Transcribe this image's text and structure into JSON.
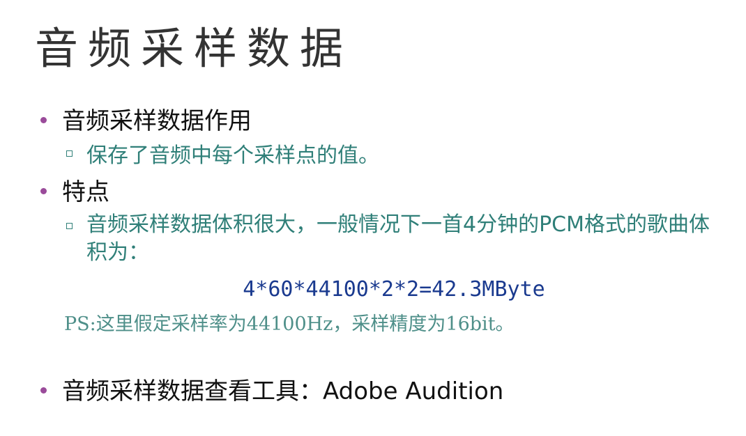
{
  "title": "音频采样数据",
  "items": [
    {
      "text": "音频采样数据作用",
      "sub": "保存了音频中每个采样点的值。"
    },
    {
      "text": "特点",
      "sub": "音频采样数据体积很大，一般情况下一首4分钟的PCM格式的歌曲体积为："
    },
    {
      "text": "音频采样数据查看工具：Adobe Audition"
    }
  ],
  "formula": "4*60*44100*2*2=42.3MByte",
  "note": "PS:这里假定采样率为44100Hz，采样精度为16bit。",
  "colors": {
    "bullet": "#9a4b9a",
    "sub_text": "#2f7f78",
    "formula": "#1a3a8f",
    "note": "#4e8f89",
    "title": "#333333"
  }
}
